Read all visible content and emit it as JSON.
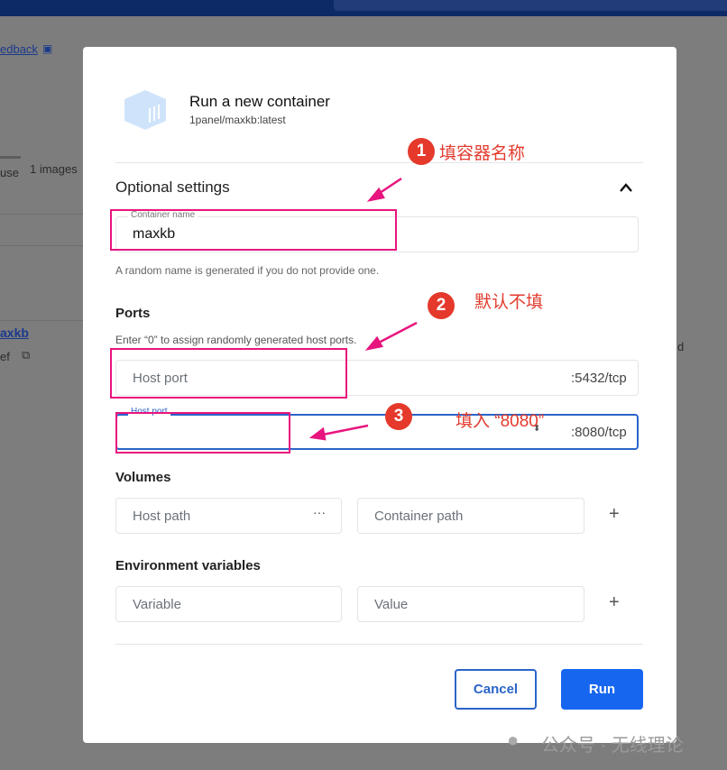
{
  "background": {
    "feedback_link": "edback",
    "use_label": "use",
    "images_count": "1 images",
    "container_link": "axkb",
    "container_id": "ef",
    "right_fragment": "d"
  },
  "dialog": {
    "title": "Run a new container",
    "image": "1panel/maxkb:latest",
    "optional_settings": "Optional settings",
    "container_name": {
      "label": "Container name",
      "value": "maxkb",
      "help": "A random name is generated if you do not provide one."
    },
    "ports": {
      "title": "Ports",
      "help": "Enter “0” to assign randomly generated host ports.",
      "rows": [
        {
          "placeholder": "Host port",
          "container_port": ":5432/tcp",
          "label": ""
        },
        {
          "placeholder": "",
          "container_port": ":8080/tcp",
          "label": "Host port"
        }
      ]
    },
    "volumes": {
      "title": "Volumes",
      "host_placeholder": "Host path",
      "container_placeholder": "Container path"
    },
    "env": {
      "title": "Environment variables",
      "variable_placeholder": "Variable",
      "value_placeholder": "Value"
    },
    "cancel": "Cancel",
    "run": "Run"
  },
  "annotations": [
    {
      "number": "1",
      "text": "填容器名称"
    },
    {
      "number": "2",
      "text": "默认不填"
    },
    {
      "number": "3",
      "text": "填入 “8080”"
    }
  ],
  "watermark": "公众号 · 无线理论",
  "colors": {
    "accent": "#1766f0",
    "annotation": "#e8157e",
    "topbar": "#0d2a66"
  }
}
